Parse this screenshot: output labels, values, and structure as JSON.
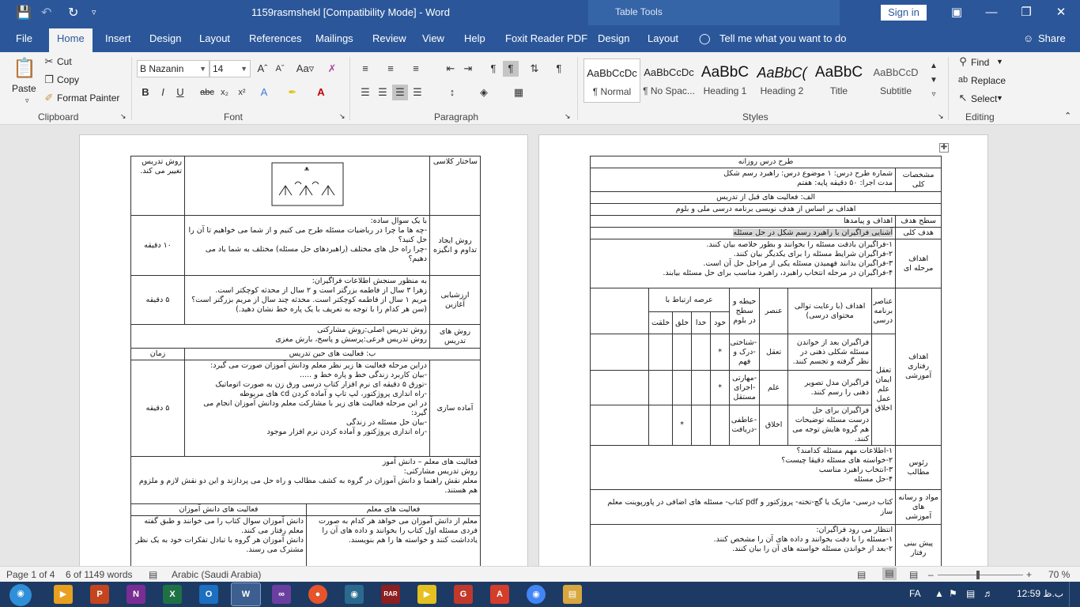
{
  "window": {
    "doc_title": "1159rasmshekl [Compatibility Mode]  -  Word",
    "context_label": "Table Tools",
    "signin": "Sign in"
  },
  "menu": {
    "tabs": [
      "File",
      "Home",
      "Insert",
      "Design",
      "Layout",
      "References",
      "Mailings",
      "Review",
      "View",
      "Help",
      "Foxit Reader PDF",
      "Design",
      "Layout"
    ],
    "tell_me": "Tell me what you want to do",
    "share": "Share"
  },
  "ribbon": {
    "clipboard": {
      "paste": "Paste",
      "cut": "Cut",
      "copy": "Copy",
      "format_painter": "Format Painter",
      "label": "Clipboard"
    },
    "font": {
      "name": "B Nazanin",
      "size": "14",
      "label": "Font"
    },
    "paragraph": {
      "label": "Paragraph"
    },
    "styles": {
      "items": [
        {
          "preview": "AaBbCcDc",
          "name": "¶ Normal"
        },
        {
          "preview": "AaBbCcDc",
          "name": "¶ No Spac..."
        },
        {
          "preview": "AaBbC",
          "name": "Heading 1"
        },
        {
          "preview": "AaBbC(",
          "name": "Heading 2"
        },
        {
          "preview": "AaBbC",
          "name": "Title"
        },
        {
          "preview": "AaBbCcD",
          "name": "Subtitle"
        }
      ],
      "label": "Styles"
    },
    "editing": {
      "find": "Find",
      "replace": "Replace",
      "select": "Select",
      "label": "Editing"
    }
  },
  "page_right": {
    "title": "طرح درس روزانه",
    "general_label": "مشخصات کلی",
    "general_text": "شماره طرح درس: ۱            موضوع درس: راهبرد رسم شکل\nمدت اجرا: ۵۰ دقیقه                                  پایه: هفتم",
    "section_a": "الف: فعالیت های قبل از تدریس",
    "objectives_basis": "اهداف بر اساس از هدف نویسی برنامه درسی ملی و بلوم",
    "level_label": "سطح هدف",
    "level_value": "اهداف و پیامدها",
    "overall_label": "هدف کلی",
    "overall_value": "آشنایی فراگیران با راهبرد رسم شکل در حل مسئله",
    "interim_label": "اهداف مرحله ای",
    "interim_text": "۱-فراگیران بادقت مسئله را بخوانند و بطور خلاصه بیان کنند.\n۲-فراگیران شرایط مسئله را برای یکدیگر بیان کنند.\n۳-فراگیران بدانند فهمیدن مسئله یکی از مراحل حل آن است.\n۴-فراگیران در مرحله انتخاب راهبرد، راهبرد مناسب برای حل مسئله بیابند.",
    "behav_label": "اهداف رفتاری آموزشی",
    "col_elements": "عناصر برنامه درسی",
    "col_objectives": "اهداف (با رعایت توالی محتوای درسی)",
    "col_element": "عنصر",
    "col_domain": "حیطه و سطح در بلوم",
    "col_relation": "عرصه ارتباط با",
    "col_self": "خود",
    "col_god": "خدا",
    "col_creation": "خلق",
    "col_nature": "خلقت",
    "elements_list": "تعقل ایمان علم عمل اخلاق",
    "rows": [
      {
        "objective": "فراگیران بعد از خواندن مسئله شکلی ذهنی در نظر گرفته و تجسم کنند.",
        "element": "تعقل",
        "domain": "-شناختی -درک و فهم",
        "self": "*",
        "god": "",
        "creation": "",
        "nature": ""
      },
      {
        "objective": "فراگیران مدل تصویر ذهنی را رسم کنند.",
        "element": "علم",
        "domain": "-مهارتی -اجرای مستقل",
        "self": "*",
        "god": "",
        "creation": "",
        "nature": ""
      },
      {
        "objective": "فراگیران برای حل درست مسئله توضیحات هم گروه هایش توجه می کنند.",
        "element": "اخلاق",
        "domain": "-عاطفی -دریافت",
        "self": "",
        "god": "",
        "creation": "*",
        "nature": ""
      }
    ],
    "headings_label": "رئوس مطالب",
    "headings_text": "۱-اطلاعات مهم مسئله کدامند؟\n۲-خواسته های مسئله دقیقا چیست؟\n۳-انتخاب راهبرد مناسب\n۴-حل مسئله",
    "materials_label": "مواد و رسانه های آموزشی",
    "materials_text": "کتاب درسی- ماژیک یا گچ-تخته- پروژکتور و pdf کتاب- مسئله های اضافی در پاورپوینت معلم ساز",
    "entry_label": "پیش بینی رفتار",
    "entry_text": "انتظار می رود فراگیران:\n۱-مسئله را با دقت بخوانند و داده های آن را مشخص کنند.\n۲-بعد از خواندن مسئله خواسته های آن را بیان کنند."
  },
  "page_left": {
    "r1_label": "ساختار کلاسی",
    "r1_right": "روش تدریس تغییر می کند.",
    "r2_label": "روش ایجاد تداوم و انگیزه",
    "r2_text": "با یک سوال ساده:\n-چه ها ما چرا در ریاضیات مسئله طرح می کنیم و از شما می خواهیم تا آن را حل کنید؟\n-چرا راه حل های مختلف (راهبردهای حل مسئله) مختلف به شما یاد می دهیم؟",
    "r2_time": "۱۰ دقیقه",
    "r3_label": "ارزشیابی آغازین",
    "r3_text": "به منظور سنجش اطلاعات فراگیران:\nزهرا ۳ سال از فاطمه بزرگتر است و ۲ سال از محدثه کوچکتر است.\nمریم ۱ سال از فاطمه کوچکتر است. محدثه چند سال از مریم بزرگتر است؟ (سن هر کدام را با توجه به تعریف با یک پاره خط نشان دهید.)",
    "r3_time": "۵ دقیقه",
    "r4_label": "روش های تدریس",
    "r4_text": "روش تدریس اصلی:روش مشارکتی\nروش تدریس فرعی:پرسش و پاسخ، بارش مغزی",
    "section_b": "ب: فعالیت های حین تدریس",
    "time_label": "زمان",
    "r5_label": "آماده سازی",
    "r5_text": "دراین مرحله فعالیت ها زیر نظر معلم ودانش آموزان صورت می گیرد:\n-بیان کاربرد زندگی خط و پاره خط و .....\n-تورق ۵ دقیقه ای نرم افزار کتاب درسی ورق زن به صورت اتوماتیک\n-راه اندازی پروژکتور، لپ تاپ و آماده کردن cd های مربوطه\nدر این مرحله فعالیت های زیر با مشارکت معلم ودانش آموزان انجام می گیرد:\n-بیان حل مسئله در زندگی\n-راه اندازی پروژکتور و آماده کردن نرم افزار موجود",
    "r5_time": "۵ دقیقه",
    "r6_text": "فعالیت های معلم – دانش آموز\nروش تدریس مشارکتی:\nمعلم نقش راهنما و دانش آموزان در گروه به کشف مطالب و راه حل می پردازند و این دو نقش لازم و ملزوم هم هستند.",
    "teacher_col": "فعالیت های معلم",
    "student_col": "فعالیت های دانش آموزان",
    "teacher_text": "معلم از دانش آموزان می خواهد هر کدام به صورت فردی مسئله اول کتاب را بخوانند و داده های آن را یادداشت کنند و خواسته ها را هم بنویسند.",
    "student_text": "دانش آموزان سوال کتاب را می خوانند و طبق گفته معلم رفتار می کنند.\nدانش آموزان هر گروه با تبادل تفکرات خود به یک نظر مشترک می رسند."
  },
  "status": {
    "page": "Page 1 of 4",
    "words": "6 of 1149 words",
    "language": "Arabic (Saudi Arabia)",
    "zoom": "70 %",
    "zoom_level": 0.47
  },
  "taskbar": {
    "lang": "FA",
    "time": "12:59 ب.ظ"
  }
}
